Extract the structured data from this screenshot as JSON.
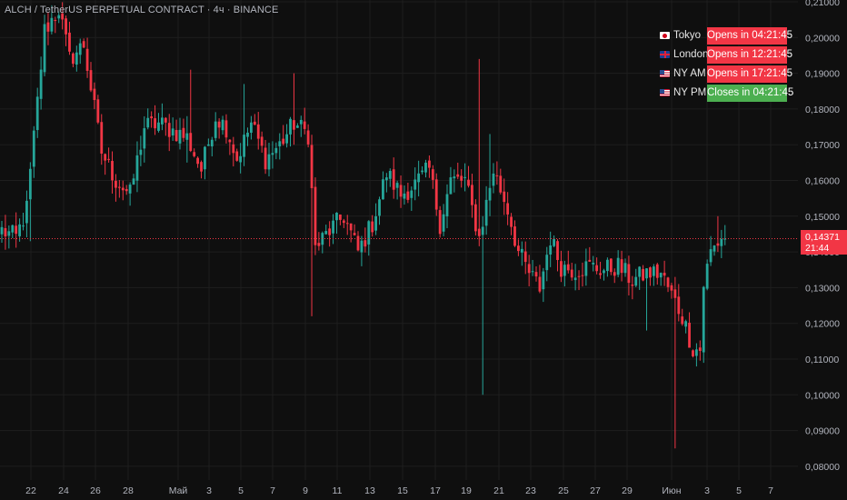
{
  "header": {
    "symbol_title": "ALCH / TetherUS PERPETUAL CONTRACT · 4ч · BINANCE"
  },
  "sessions": [
    {
      "flag": "jp",
      "name": "Tokyo",
      "status": "Opens in 04:21:45",
      "state": "open"
    },
    {
      "flag": "gb",
      "name": "London",
      "status": "Opens in 12:21:45",
      "state": "open"
    },
    {
      "flag": "us",
      "name": "NY AM",
      "status": "Opens in 17:21:45",
      "state": "open"
    },
    {
      "flag": "us",
      "name": "NY PM",
      "status": "Closes in 04:21:45",
      "state": "close"
    }
  ],
  "last_price": {
    "price": "0,14371",
    "countdown": "21:44",
    "value": 0.14371
  },
  "colors": {
    "up": "#26a69a",
    "down": "#f23645",
    "background": "#0f0f0f",
    "grid": "#1e1e1e",
    "text": "#b2b5be"
  },
  "chart_data": {
    "type": "candlestick",
    "timeframe": "4ч",
    "y_ticks": [
      "0,21000",
      "0,20000",
      "0,19000",
      "0,18000",
      "0,17000",
      "0,16000",
      "0,15000",
      "0,14000",
      "0,13000",
      "0,12000",
      "0,11000",
      "0,10000",
      "0,09000",
      "0,08000"
    ],
    "ylim": [
      0.0765,
      0.2115
    ],
    "x_ticks": [
      "22",
      "24",
      "26",
      "28",
      "Май",
      "3",
      "5",
      "7",
      "9",
      "11",
      "13",
      "15",
      "17",
      "19",
      "21",
      "23",
      "25",
      "27",
      "29",
      "Июн",
      "3",
      "5",
      "7"
    ],
    "anchors": [
      {
        "i": 0,
        "v": 0.146
      },
      {
        "i": 4,
        "v": 0.144
      },
      {
        "i": 7,
        "v": 0.152
      },
      {
        "i": 12,
        "v": 0.202
      },
      {
        "i": 16,
        "v": 0.208
      },
      {
        "i": 19,
        "v": 0.194
      },
      {
        "i": 23,
        "v": 0.198
      },
      {
        "i": 28,
        "v": 0.168
      },
      {
        "i": 32,
        "v": 0.16
      },
      {
        "i": 36,
        "v": 0.156
      },
      {
        "i": 40,
        "v": 0.175
      },
      {
        "i": 44,
        "v": 0.176
      },
      {
        "i": 48,
        "v": 0.174
      },
      {
        "i": 52,
        "v": 0.172
      },
      {
        "i": 56,
        "v": 0.163
      },
      {
        "i": 60,
        "v": 0.178
      },
      {
        "i": 63,
        "v": 0.175
      },
      {
        "i": 66,
        "v": 0.166
      },
      {
        "i": 70,
        "v": 0.176
      },
      {
        "i": 74,
        "v": 0.166
      },
      {
        "i": 78,
        "v": 0.17
      },
      {
        "i": 82,
        "v": 0.176
      },
      {
        "i": 86,
        "v": 0.173
      },
      {
        "i": 88,
        "v": 0.141
      },
      {
        "i": 92,
        "v": 0.146
      },
      {
        "i": 96,
        "v": 0.15
      },
      {
        "i": 100,
        "v": 0.14
      },
      {
        "i": 104,
        "v": 0.148
      },
      {
        "i": 108,
        "v": 0.162
      },
      {
        "i": 112,
        "v": 0.156
      },
      {
        "i": 116,
        "v": 0.159
      },
      {
        "i": 120,
        "v": 0.163
      },
      {
        "i": 123,
        "v": 0.148
      },
      {
        "i": 126,
        "v": 0.16
      },
      {
        "i": 130,
        "v": 0.16
      },
      {
        "i": 134,
        "v": 0.144
      },
      {
        "i": 138,
        "v": 0.163
      },
      {
        "i": 142,
        "v": 0.152
      },
      {
        "i": 145,
        "v": 0.14
      },
      {
        "i": 148,
        "v": 0.134
      },
      {
        "i": 151,
        "v": 0.13
      },
      {
        "i": 154,
        "v": 0.144
      },
      {
        "i": 157,
        "v": 0.136
      },
      {
        "i": 161,
        "v": 0.135
      },
      {
        "i": 165,
        "v": 0.136
      },
      {
        "i": 169,
        "v": 0.135
      },
      {
        "i": 173,
        "v": 0.136
      },
      {
        "i": 177,
        "v": 0.132
      },
      {
        "i": 181,
        "v": 0.134
      },
      {
        "i": 185,
        "v": 0.134
      },
      {
        "i": 188,
        "v": 0.128
      },
      {
        "i": 191,
        "v": 0.122
      },
      {
        "i": 194,
        "v": 0.113
      },
      {
        "i": 196,
        "v": 0.1125
      },
      {
        "i": 197,
        "v": 0.131
      },
      {
        "i": 199,
        "v": 0.14
      },
      {
        "i": 202,
        "v": 0.144
      },
      {
        "i": 203,
        "v": 0.1437
      }
    ],
    "spikes": [
      {
        "i": 8,
        "hi": 0.152,
        "lo": 0.143
      },
      {
        "i": 52,
        "hi": 0.178,
        "lo": 0.165
      },
      {
        "i": 53,
        "hi": 0.191,
        "lo": 0.168
      },
      {
        "i": 68,
        "hi": 0.187,
        "lo": 0.164
      },
      {
        "i": 82,
        "hi": 0.19,
        "lo": 0.17
      },
      {
        "i": 87,
        "hi": 0.166,
        "lo": 0.122
      },
      {
        "i": 134,
        "hi": 0.194,
        "lo": 0.145
      },
      {
        "i": 135,
        "hi": 0.15,
        "lo": 0.1
      },
      {
        "i": 137,
        "hi": 0.173,
        "lo": 0.15
      },
      {
        "i": 181,
        "hi": 0.135,
        "lo": 0.118
      },
      {
        "i": 189,
        "hi": 0.133,
        "lo": 0.085
      },
      {
        "i": 201,
        "hi": 0.15,
        "lo": 0.14
      }
    ]
  }
}
